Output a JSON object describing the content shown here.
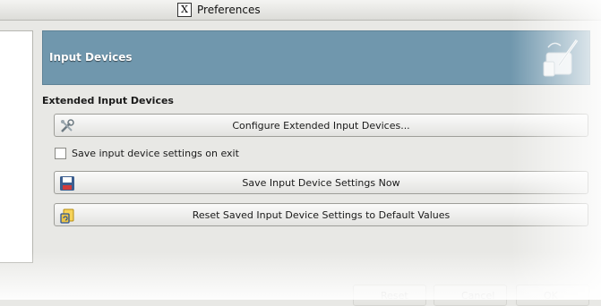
{
  "window": {
    "title": "Preferences",
    "title_icon": "x-window-icon"
  },
  "banner": {
    "title": "Input Devices",
    "icon": "tablet-pen-icon"
  },
  "section": {
    "title": "Extended Input Devices"
  },
  "buttons": {
    "configure": {
      "label": "Configure Extended Input Devices...",
      "icon": "tools-icon"
    },
    "save_now": {
      "label": "Save Input Device Settings Now",
      "icon": "floppy-disk-icon"
    },
    "reset": {
      "label": "Reset Saved Input Device Settings to Default Values",
      "icon": "reset-icon"
    }
  },
  "checkbox": {
    "label": "Save input device settings on exit",
    "checked": false
  },
  "footer": {
    "reset": "Reset",
    "cancel": "Cancel",
    "ok": "OK"
  },
  "colors": {
    "banner_bg": "#7097ad",
    "window_bg": "#e8e8e5"
  }
}
